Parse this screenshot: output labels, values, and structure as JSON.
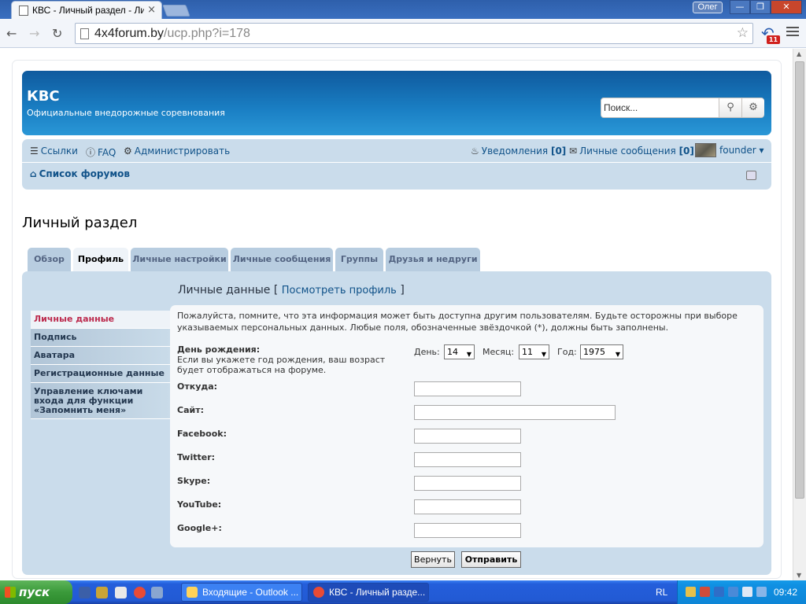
{
  "browser": {
    "tab_title": "КВС - Личный раздел - Лич",
    "tab_close": "×",
    "user_badge": "Олег",
    "url_host": "4x4forum.by",
    "url_path": "/ucp.php?i=178",
    "ext_badge": "11",
    "win_min": "—",
    "win_max": "❐",
    "win_close": "✕",
    "nav_back": "←",
    "nav_fwd": "→",
    "nav_reload": "↻",
    "star": "☆"
  },
  "site": {
    "title": "КВС",
    "description": "Официальные внедорожные соревнования",
    "search_placeholder": "Поиск..."
  },
  "navbar": {
    "links": "Ссылки",
    "faq": "FAQ",
    "admin": "Администрировать",
    "notifications_label": "Уведомления",
    "notifications_count": "[0]",
    "messages_label": "Личные сообщения",
    "messages_count": "[0]",
    "username": "founder ▾",
    "forums": "Список форумов"
  },
  "page_title": "Личный раздел",
  "tabs": [
    "Обзор",
    "Профиль",
    "Личные настройки",
    "Личные сообщения",
    "Группы",
    "Друзья и недруги"
  ],
  "menu": [
    "Личные данные",
    "Подпись",
    "Аватара",
    "Регистрационные данные",
    "Управление ключами входа для функции «Запомнить меня»"
  ],
  "section": {
    "title": "Личные данные",
    "bracket_open": "[",
    "view_profile": "Посмотреть профиль",
    "bracket_close": "]",
    "notice": "Пожалуйста, помните, что эта информация может быть доступна другим пользователям. Будьте осторожны при выборе указываемых персональных данных. Любые поля, обозначенные звёздочкой (*), должны быть заполнены."
  },
  "birthday": {
    "label": "День рождения:",
    "desc": "Если вы укажете год рождения, ваш возраст будет отображаться на форуме.",
    "day_label": "День:",
    "day_value": "14",
    "month_label": "Месяц:",
    "month_value": "11",
    "year_label": "Год:",
    "year_value": "1975"
  },
  "fields": {
    "from": "Откуда:",
    "site": "Сайт:",
    "facebook": "Facebook:",
    "twitter": "Twitter:",
    "skype": "Skype:",
    "youtube": "YouTube:",
    "googleplus": "Google+:"
  },
  "buttons": {
    "back": "Вернуть",
    "submit": "Отправить"
  },
  "taskbar": {
    "start": "пуск",
    "task1": "Входящие - Outlook ...",
    "task2": "КВС - Личный разде...",
    "lang": "RL",
    "clock": "09:42"
  },
  "colors": {
    "header_blue": "#1a7fc4",
    "nav_bg": "#cadceb",
    "link": "#105289",
    "active_menu": "#bc2a4d"
  }
}
